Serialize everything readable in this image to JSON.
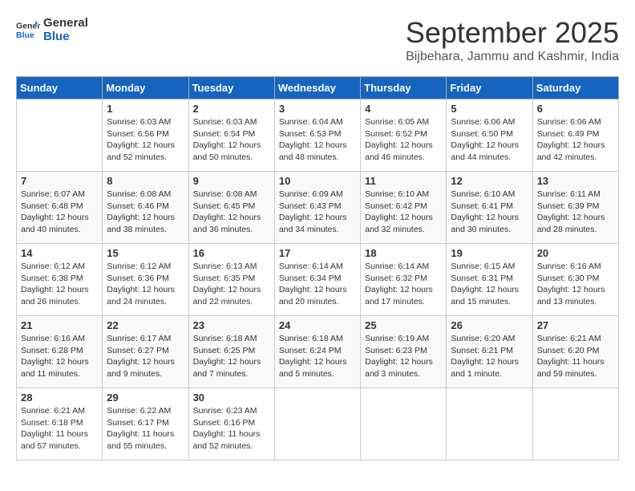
{
  "logo": {
    "line1": "General",
    "line2": "Blue"
  },
  "title": "September 2025",
  "location": "Bijbehara, Jammu and Kashmir, India",
  "days_of_week": [
    "Sunday",
    "Monday",
    "Tuesday",
    "Wednesday",
    "Thursday",
    "Friday",
    "Saturday"
  ],
  "weeks": [
    [
      {
        "day": "",
        "sunrise": "",
        "sunset": "",
        "daylight": ""
      },
      {
        "day": "1",
        "sunrise": "Sunrise: 6:03 AM",
        "sunset": "Sunset: 6:56 PM",
        "daylight": "Daylight: 12 hours and 52 minutes."
      },
      {
        "day": "2",
        "sunrise": "Sunrise: 6:03 AM",
        "sunset": "Sunset: 6:54 PM",
        "daylight": "Daylight: 12 hours and 50 minutes."
      },
      {
        "day": "3",
        "sunrise": "Sunrise: 6:04 AM",
        "sunset": "Sunset: 6:53 PM",
        "daylight": "Daylight: 12 hours and 48 minutes."
      },
      {
        "day": "4",
        "sunrise": "Sunrise: 6:05 AM",
        "sunset": "Sunset: 6:52 PM",
        "daylight": "Daylight: 12 hours and 46 minutes."
      },
      {
        "day": "5",
        "sunrise": "Sunrise: 6:06 AM",
        "sunset": "Sunset: 6:50 PM",
        "daylight": "Daylight: 12 hours and 44 minutes."
      },
      {
        "day": "6",
        "sunrise": "Sunrise: 6:06 AM",
        "sunset": "Sunset: 6:49 PM",
        "daylight": "Daylight: 12 hours and 42 minutes."
      }
    ],
    [
      {
        "day": "7",
        "sunrise": "Sunrise: 6:07 AM",
        "sunset": "Sunset: 6:48 PM",
        "daylight": "Daylight: 12 hours and 40 minutes."
      },
      {
        "day": "8",
        "sunrise": "Sunrise: 6:08 AM",
        "sunset": "Sunset: 6:46 PM",
        "daylight": "Daylight: 12 hours and 38 minutes."
      },
      {
        "day": "9",
        "sunrise": "Sunrise: 6:08 AM",
        "sunset": "Sunset: 6:45 PM",
        "daylight": "Daylight: 12 hours and 36 minutes."
      },
      {
        "day": "10",
        "sunrise": "Sunrise: 6:09 AM",
        "sunset": "Sunset: 6:43 PM",
        "daylight": "Daylight: 12 hours and 34 minutes."
      },
      {
        "day": "11",
        "sunrise": "Sunrise: 6:10 AM",
        "sunset": "Sunset: 6:42 PM",
        "daylight": "Daylight: 12 hours and 32 minutes."
      },
      {
        "day": "12",
        "sunrise": "Sunrise: 6:10 AM",
        "sunset": "Sunset: 6:41 PM",
        "daylight": "Daylight: 12 hours and 30 minutes."
      },
      {
        "day": "13",
        "sunrise": "Sunrise: 6:11 AM",
        "sunset": "Sunset: 6:39 PM",
        "daylight": "Daylight: 12 hours and 28 minutes."
      }
    ],
    [
      {
        "day": "14",
        "sunrise": "Sunrise: 6:12 AM",
        "sunset": "Sunset: 6:38 PM",
        "daylight": "Daylight: 12 hours and 26 minutes."
      },
      {
        "day": "15",
        "sunrise": "Sunrise: 6:12 AM",
        "sunset": "Sunset: 6:36 PM",
        "daylight": "Daylight: 12 hours and 24 minutes."
      },
      {
        "day": "16",
        "sunrise": "Sunrise: 6:13 AM",
        "sunset": "Sunset: 6:35 PM",
        "daylight": "Daylight: 12 hours and 22 minutes."
      },
      {
        "day": "17",
        "sunrise": "Sunrise: 6:14 AM",
        "sunset": "Sunset: 6:34 PM",
        "daylight": "Daylight: 12 hours and 20 minutes."
      },
      {
        "day": "18",
        "sunrise": "Sunrise: 6:14 AM",
        "sunset": "Sunset: 6:32 PM",
        "daylight": "Daylight: 12 hours and 17 minutes."
      },
      {
        "day": "19",
        "sunrise": "Sunrise: 6:15 AM",
        "sunset": "Sunset: 6:31 PM",
        "daylight": "Daylight: 12 hours and 15 minutes."
      },
      {
        "day": "20",
        "sunrise": "Sunrise: 6:16 AM",
        "sunset": "Sunset: 6:30 PM",
        "daylight": "Daylight: 12 hours and 13 minutes."
      }
    ],
    [
      {
        "day": "21",
        "sunrise": "Sunrise: 6:16 AM",
        "sunset": "Sunset: 6:28 PM",
        "daylight": "Daylight: 12 hours and 11 minutes."
      },
      {
        "day": "22",
        "sunrise": "Sunrise: 6:17 AM",
        "sunset": "Sunset: 6:27 PM",
        "daylight": "Daylight: 12 hours and 9 minutes."
      },
      {
        "day": "23",
        "sunrise": "Sunrise: 6:18 AM",
        "sunset": "Sunset: 6:25 PM",
        "daylight": "Daylight: 12 hours and 7 minutes."
      },
      {
        "day": "24",
        "sunrise": "Sunrise: 6:18 AM",
        "sunset": "Sunset: 6:24 PM",
        "daylight": "Daylight: 12 hours and 5 minutes."
      },
      {
        "day": "25",
        "sunrise": "Sunrise: 6:19 AM",
        "sunset": "Sunset: 6:23 PM",
        "daylight": "Daylight: 12 hours and 3 minutes."
      },
      {
        "day": "26",
        "sunrise": "Sunrise: 6:20 AM",
        "sunset": "Sunset: 6:21 PM",
        "daylight": "Daylight: 12 hours and 1 minute."
      },
      {
        "day": "27",
        "sunrise": "Sunrise: 6:21 AM",
        "sunset": "Sunset: 6:20 PM",
        "daylight": "Daylight: 11 hours and 59 minutes."
      }
    ],
    [
      {
        "day": "28",
        "sunrise": "Sunrise: 6:21 AM",
        "sunset": "Sunset: 6:18 PM",
        "daylight": "Daylight: 11 hours and 57 minutes."
      },
      {
        "day": "29",
        "sunrise": "Sunrise: 6:22 AM",
        "sunset": "Sunset: 6:17 PM",
        "daylight": "Daylight: 11 hours and 55 minutes."
      },
      {
        "day": "30",
        "sunrise": "Sunrise: 6:23 AM",
        "sunset": "Sunset: 6:16 PM",
        "daylight": "Daylight: 11 hours and 52 minutes."
      },
      {
        "day": "",
        "sunrise": "",
        "sunset": "",
        "daylight": ""
      },
      {
        "day": "",
        "sunrise": "",
        "sunset": "",
        "daylight": ""
      },
      {
        "day": "",
        "sunrise": "",
        "sunset": "",
        "daylight": ""
      },
      {
        "day": "",
        "sunrise": "",
        "sunset": "",
        "daylight": ""
      }
    ]
  ]
}
